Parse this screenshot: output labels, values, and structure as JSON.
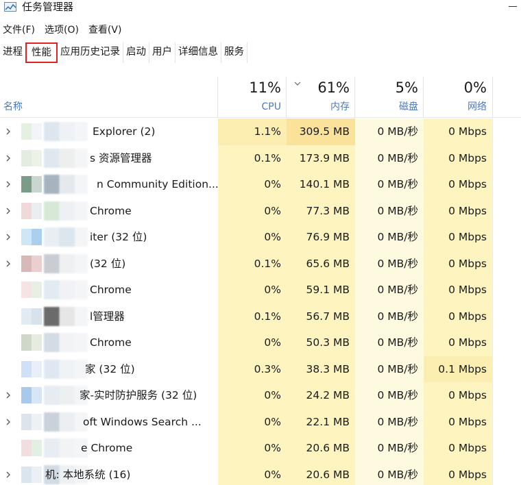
{
  "window": {
    "title": "任务管理器"
  },
  "menu": [
    "文件(F)",
    "选项(O)",
    "查看(V)"
  ],
  "tabs": [
    {
      "label": "进程"
    },
    {
      "label": "性能"
    },
    {
      "label": "应用历史记录"
    },
    {
      "label": "启动"
    },
    {
      "label": "用户"
    },
    {
      "label": "详细信息"
    },
    {
      "label": "服务"
    }
  ],
  "columns": {
    "name": "名称",
    "cpu": {
      "percent": "11%",
      "label": "CPU"
    },
    "memory": {
      "percent": "61%",
      "label": "内存"
    },
    "disk": {
      "percent": "5%",
      "label": "磁盘"
    },
    "network": {
      "percent": "0%",
      "label": "网络"
    }
  },
  "processes": [
    {
      "name": "Explorer (2)",
      "expandable": true,
      "cpu": "1.1%",
      "memory": "309.5 MB",
      "disk": "0 MB/秒",
      "network": "0 Mbps"
    },
    {
      "name": "s 资源管理器",
      "expandable": true,
      "cpu": "0.1%",
      "memory": "173.9 MB",
      "disk": "0 MB/秒",
      "network": "0 Mbps"
    },
    {
      "name": "n Community Edition...",
      "expandable": true,
      "cpu": "0%",
      "memory": "140.1 MB",
      "disk": "0 MB/秒",
      "network": "0 Mbps"
    },
    {
      "name": "Chrome",
      "expandable": true,
      "cpu": "0%",
      "memory": "77.3 MB",
      "disk": "0 MB/秒",
      "network": "0 Mbps"
    },
    {
      "name": "iter (32 位)",
      "expandable": true,
      "cpu": "0%",
      "memory": "76.9 MB",
      "disk": "0 MB/秒",
      "network": "0 Mbps"
    },
    {
      "name": "(32 位)",
      "expandable": true,
      "cpu": "0.1%",
      "memory": "65.6 MB",
      "disk": "0 MB/秒",
      "network": "0 Mbps"
    },
    {
      "name": "Chrome",
      "expandable": false,
      "cpu": "0%",
      "memory": "59.1 MB",
      "disk": "0 MB/秒",
      "network": "0 Mbps"
    },
    {
      "name": "l管理器",
      "expandable": false,
      "cpu": "0.1%",
      "memory": "56.7 MB",
      "disk": "0 MB/秒",
      "network": "0 Mbps"
    },
    {
      "name": "Chrome",
      "expandable": false,
      "cpu": "0%",
      "memory": "50.3 MB",
      "disk": "0 MB/秒",
      "network": "0 Mbps"
    },
    {
      "name": "家 (32 位)",
      "expandable": false,
      "cpu": "0.3%",
      "memory": "38.3 MB",
      "disk": "0 MB/秒",
      "network": "0.1 Mbps"
    },
    {
      "name": "家-实时防护服务 (32 位)",
      "expandable": true,
      "cpu": "0%",
      "memory": "24.2 MB",
      "disk": "0 MB/秒",
      "network": "0 Mbps"
    },
    {
      "name": "oft Windows Search ...",
      "expandable": true,
      "cpu": "0%",
      "memory": "22.1 MB",
      "disk": "0 MB/秒",
      "network": "0 Mbps"
    },
    {
      "name": "e Chrome",
      "expandable": false,
      "cpu": "0%",
      "memory": "20.6 MB",
      "disk": "0 MB/秒",
      "network": "0 Mbps"
    },
    {
      "name": "机: 本地系统 (16)",
      "expandable": true,
      "cpu": "0%",
      "memory": "20.6 MB",
      "disk": "0 MB/秒",
      "network": "0 Mbps"
    }
  ],
  "colors": {
    "cpu_cell": "#fdf4bf",
    "memory_cell_hot": "#fbe29a",
    "header_label": "#4d78b8",
    "active_tab_highlight": "#e02020"
  }
}
